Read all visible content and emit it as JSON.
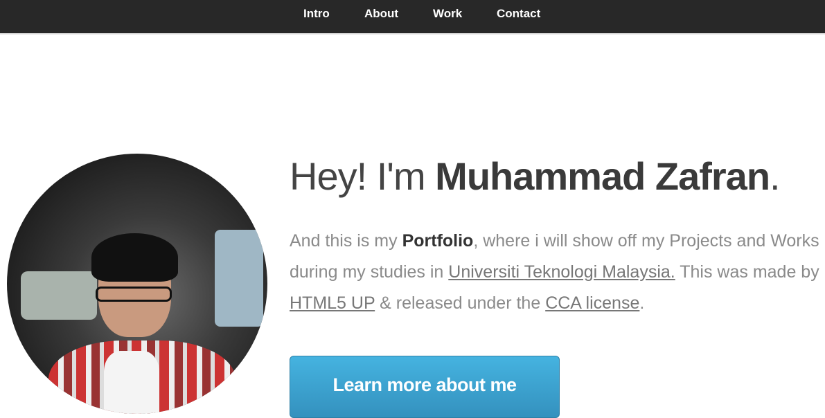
{
  "nav": {
    "items": [
      {
        "label": "Intro"
      },
      {
        "label": "About"
      },
      {
        "label": "Work"
      },
      {
        "label": "Contact"
      }
    ]
  },
  "intro": {
    "greeting": "Hey! I'm ",
    "name": "Muhammad Zafran",
    "period": ".",
    "p1": "And this is my ",
    "portfolio": "Portfolio",
    "p2": ", where i will show off my Projects and Works during my studies in ",
    "uni_link": "Universiti Teknologi Malaysia.",
    "p3": " This was made by ",
    "html5up_link": "HTML5 UP",
    "p4": " & released under the ",
    "license_link": "CCA license",
    "p5": ".",
    "button": "Learn more about me"
  },
  "colors": {
    "nav_bg": "#282828",
    "button": "#3ea5d4"
  }
}
